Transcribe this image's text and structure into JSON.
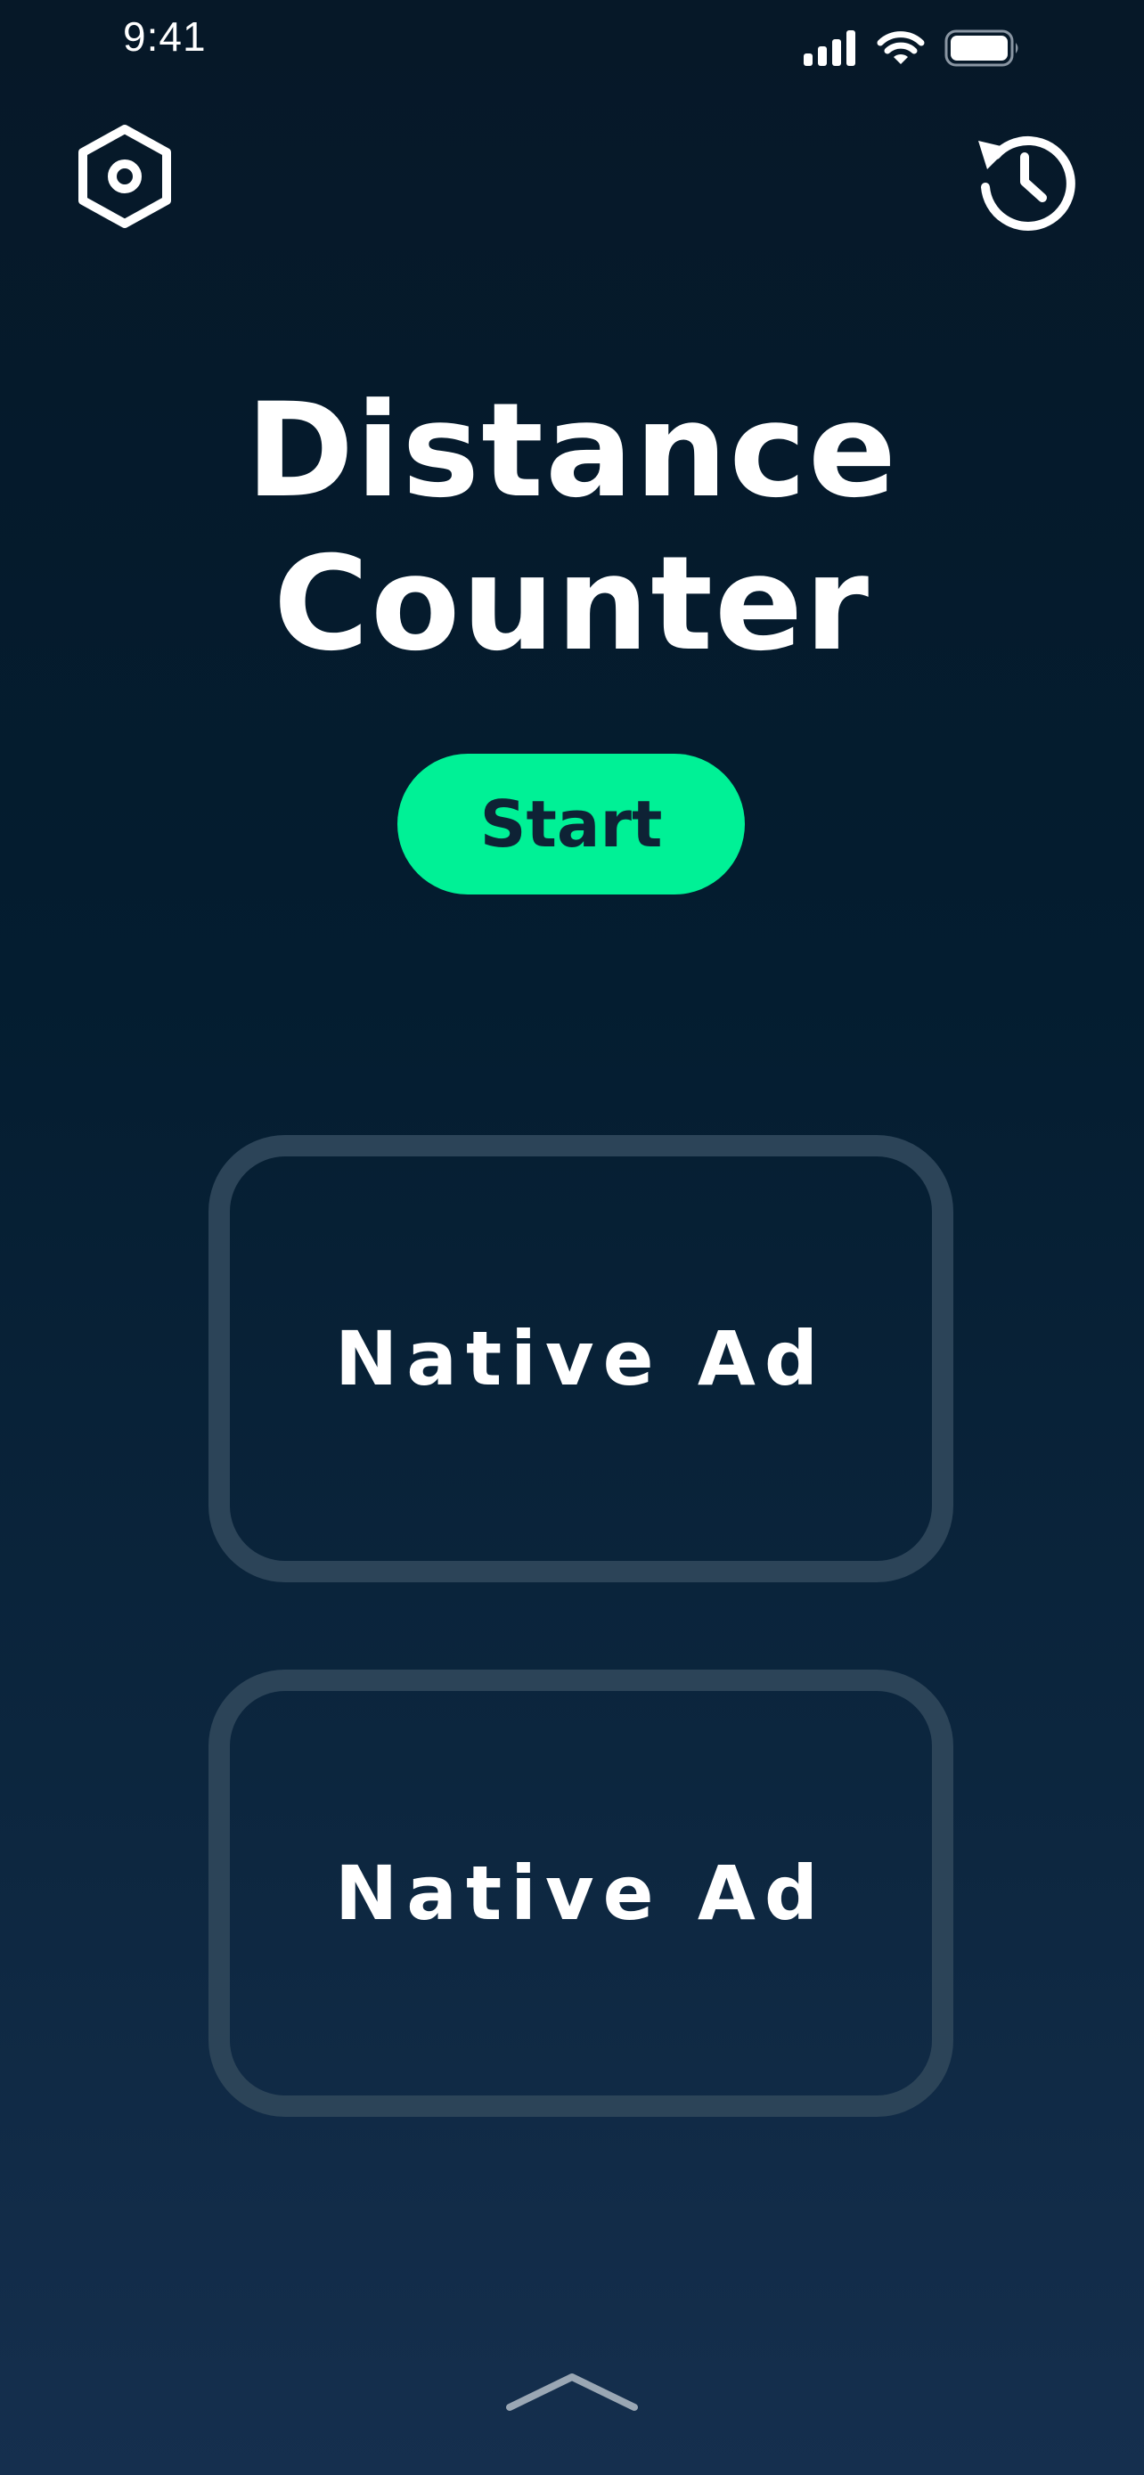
{
  "status_bar": {
    "time": "9:41",
    "icons": [
      "cellular-signal-icon",
      "wifi-icon",
      "battery-icon"
    ]
  },
  "header": {
    "left_icon": "settings-hexagon-icon",
    "right_icon": "history-clock-icon"
  },
  "title": {
    "line1": "Distance",
    "line2": "Counter"
  },
  "start_button": {
    "label": "Start"
  },
  "ads": [
    {
      "label": "Native Ad"
    },
    {
      "label": "Native Ad"
    }
  ],
  "footer": {
    "icon": "chevron-up-icon"
  },
  "colors": {
    "accent": "#00f196",
    "background_top": "#061828",
    "background_bottom": "#152f4e",
    "card_border": "#2c4458",
    "button_text": "#0e2235"
  }
}
